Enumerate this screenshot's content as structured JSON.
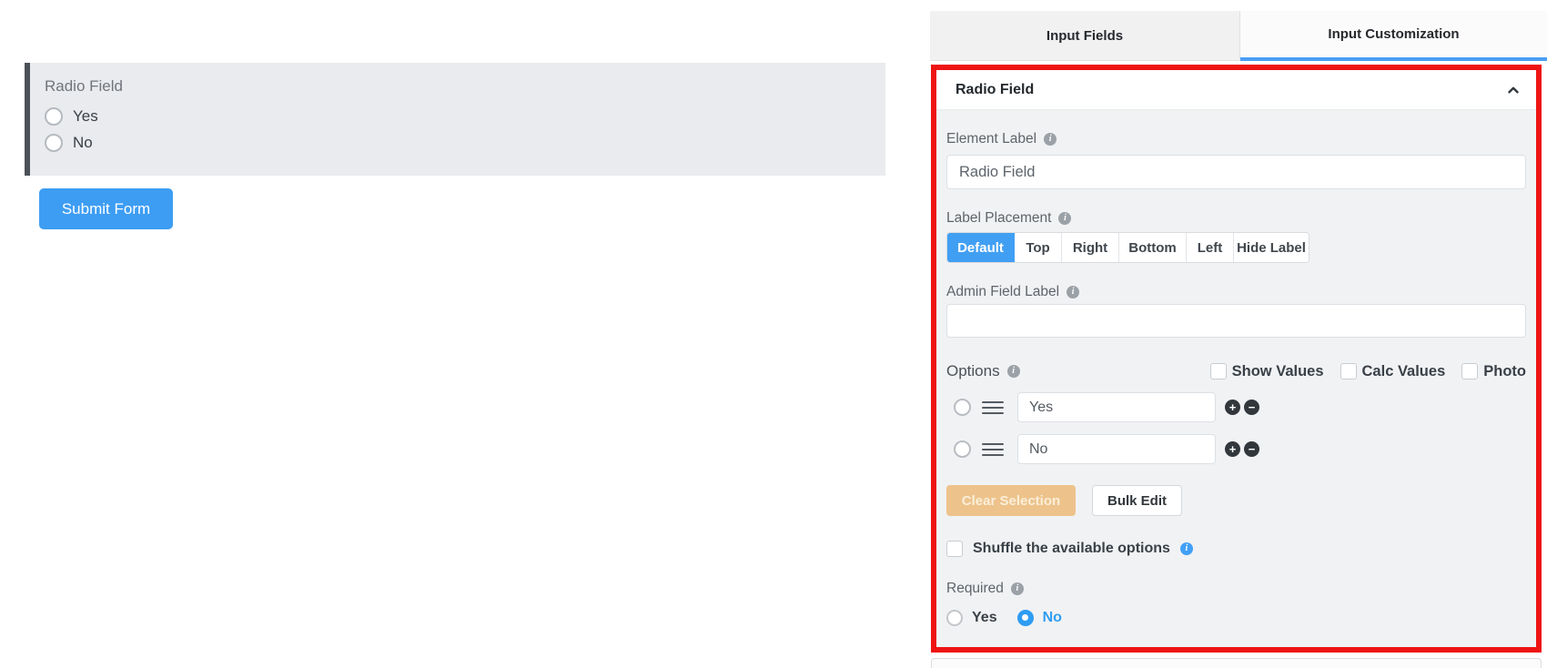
{
  "preview": {
    "field_label": "Radio Field",
    "options": [
      {
        "label": "Yes"
      },
      {
        "label": "No"
      }
    ],
    "submit_label": "Submit Form"
  },
  "tabs": {
    "input_fields": "Input Fields",
    "input_customization": "Input Customization",
    "active": "Input Customization"
  },
  "panel": {
    "title": "Radio Field",
    "element_label": {
      "label": "Element Label",
      "value": "Radio Field"
    },
    "label_placement": {
      "label": "Label Placement",
      "options": [
        "Default",
        "Top",
        "Right",
        "Bottom",
        "Left",
        "Hide Label"
      ],
      "selected": "Default"
    },
    "admin_field_label": {
      "label": "Admin Field Label",
      "value": ""
    },
    "options_section": {
      "label": "Options",
      "column_toggles": [
        "Show Values",
        "Calc Values",
        "Photo"
      ],
      "rows": [
        {
          "value": "Yes"
        },
        {
          "value": "No"
        }
      ],
      "clear_selection_label": "Clear Selection",
      "bulk_edit_label": "Bulk Edit",
      "shuffle_label": "Shuffle the available options"
    },
    "required": {
      "label": "Required",
      "option_yes": "Yes",
      "option_no": "No",
      "selected": "No"
    }
  },
  "colors": {
    "accent_blue": "#3d9df3",
    "annotation_red": "#ee1414",
    "panel_body_bg": "#f1f2f4",
    "preview_box_bg": "#e9ebee",
    "clear_button_bg": "#edc38b"
  }
}
